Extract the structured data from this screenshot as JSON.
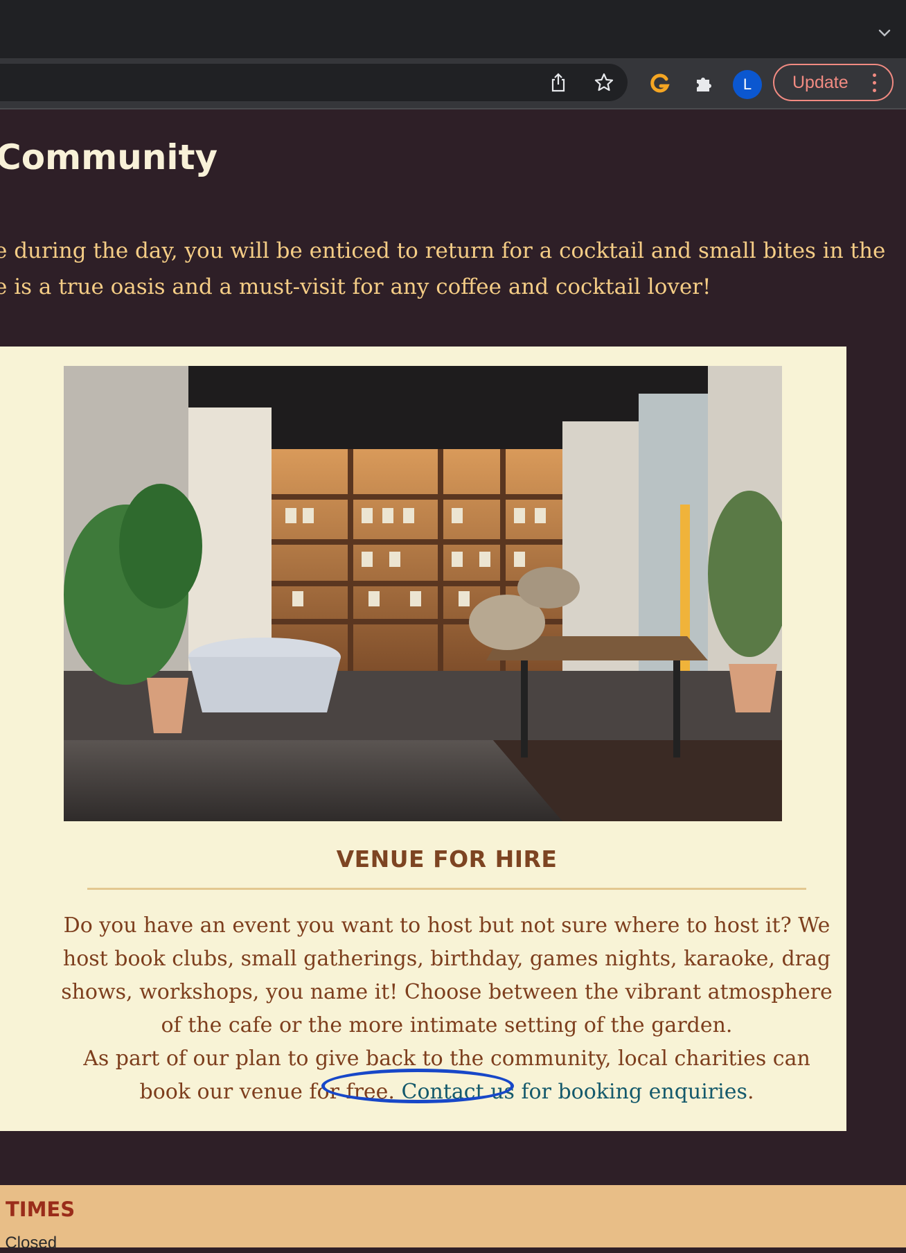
{
  "browser": {
    "update_label": "Update",
    "avatar_letter": "L",
    "icons": [
      "chevron-down-icon",
      "share-icon",
      "star-icon",
      "grammarly-icon",
      "extensions-icon",
      "menu-icon"
    ]
  },
  "page": {
    "heading": "Community",
    "intro_line_1": "e during the day, you will be enticed to return for a cocktail and small bites in the",
    "intro_line_2": "e is a true oasis and a must-visit for any coffee and cocktail lover!"
  },
  "venue": {
    "image_description": "cafe interior with bookshelves, tables and plants",
    "title": "VENUE FOR HIRE",
    "paragraph_1": "Do you have an event you want to host but not sure where to host it? We host book clubs, small gatherings, birthday, games nights, karaoke, drag shows, workshops, you name it! Choose between the vibrant atmosphere of the cafe or the more intimate setting of the garden.",
    "paragraph_2_before": "As part of our plan to give back to the community, local charities can book our venue for free. ",
    "contact_link": "Contact us for booking enquiries",
    "paragraph_2_after": "."
  },
  "footer": {
    "title": "TIMES",
    "line": "s: Closed"
  },
  "colors": {
    "page_bg": "#2e1f27",
    "card_bg": "#f8f3d6",
    "accent": "#7d4422",
    "link": "#14596b",
    "annotation": "#1747c8"
  }
}
